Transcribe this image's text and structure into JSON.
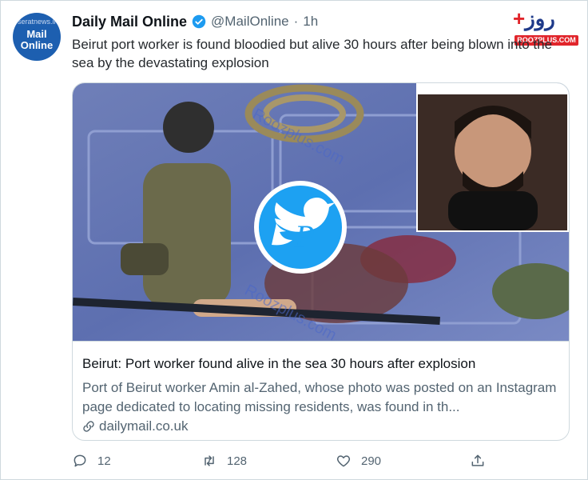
{
  "account": {
    "name": "Daily Mail Online",
    "handle": "@MailOnline",
    "dot": "·",
    "time": "1h",
    "avatar_text": "Mail Online",
    "avatar_watermark": "seratnews.ir"
  },
  "tweet": {
    "text": "Beirut port worker is found bloodied but alive 30 hours after being blown into the sea by the devastating explosion"
  },
  "card": {
    "title": "Beirut: Port worker found alive in the sea 30 hours after explosion",
    "description": "Port of Beirut worker Amin al-Zahed, whose photo was posted on an Instagram page dedicated to locating missing residents, was found in th...",
    "link": "dailymail.co.uk"
  },
  "actions": {
    "reply_count": "12",
    "retweet_count": "128",
    "like_count": "290"
  },
  "overlay": {
    "roozplus_logo": "روز",
    "roozplus_plus": "+",
    "roozplus_tag": "ROOZPLUS.COM",
    "watermark_text": "Roozplus.com"
  },
  "colors": {
    "verified": "#1d9bf0",
    "text_secondary": "#536471",
    "border": "#cfd9de",
    "twitter_blue": "#1da1f2"
  },
  "icons": [
    "verified-badge-icon",
    "link-icon",
    "reply-icon",
    "retweet-icon",
    "like-icon",
    "share-icon",
    "twitter-bird-icon"
  ]
}
